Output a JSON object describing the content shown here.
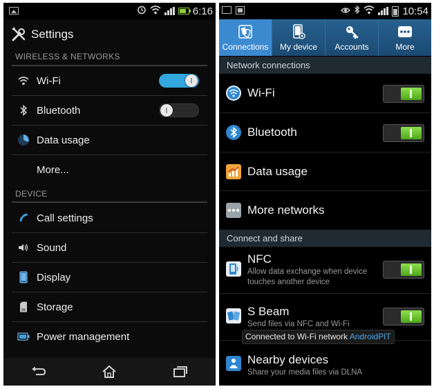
{
  "left": {
    "status": {
      "time": "6:16"
    },
    "title": "Settings",
    "sections": [
      {
        "heading": "WIRELESS & NETWORKS",
        "items": [
          {
            "label": "Wi-Fi",
            "icon": "wifi-icon",
            "toggle": true
          },
          {
            "label": "Bluetooth",
            "icon": "bluetooth-icon",
            "toggle": false
          },
          {
            "label": "Data usage",
            "icon": "data-usage-icon"
          },
          {
            "label": "More..."
          }
        ]
      },
      {
        "heading": "DEVICE",
        "items": [
          {
            "label": "Call settings",
            "icon": "phone-icon"
          },
          {
            "label": "Sound",
            "icon": "speaker-icon"
          },
          {
            "label": "Display",
            "icon": "display-icon"
          },
          {
            "label": "Storage",
            "icon": "storage-icon"
          },
          {
            "label": "Power management",
            "icon": "battery-icon"
          }
        ]
      }
    ],
    "colors": {
      "toggle_on": "#33a6e0"
    }
  },
  "right": {
    "status": {
      "time": "10:54"
    },
    "tabs": [
      {
        "label": "Connections",
        "icon": "connections-icon",
        "active": true
      },
      {
        "label": "My device",
        "icon": "my-device-icon"
      },
      {
        "label": "Accounts",
        "icon": "key-icon"
      },
      {
        "label": "More",
        "icon": "more-dots-icon"
      }
    ],
    "sections": [
      {
        "heading": "Network connections",
        "items": [
          {
            "label": "Wi-Fi",
            "icon": "wifi-icon",
            "toggle": true
          },
          {
            "label": "Bluetooth",
            "icon": "bluetooth-icon",
            "toggle": true
          },
          {
            "label": "Data usage",
            "icon": "data-usage-icon"
          },
          {
            "label": "More networks",
            "icon": "more-dots-icon"
          }
        ]
      },
      {
        "heading": "Connect and share",
        "items": [
          {
            "label": "NFC",
            "sub": "Allow data exchange when device touches another device",
            "icon": "nfc-icon",
            "toggle": true
          },
          {
            "label": "S Beam",
            "sub": "Send files via NFC and Wi-Fi",
            "icon": "s-beam-icon",
            "toggle": true
          },
          {
            "label": "Nearby devices",
            "sub": "Share your media files via DLNA",
            "icon": "nearby-devices-icon"
          }
        ]
      }
    ],
    "toast": {
      "text": "Connected to Wi-Fi network ",
      "network": "AndroidPIT"
    },
    "colors": {
      "toggle_on": "#6cc83a",
      "tab_active": "#3b8ad0",
      "header_bg": "#1f2a33"
    }
  }
}
